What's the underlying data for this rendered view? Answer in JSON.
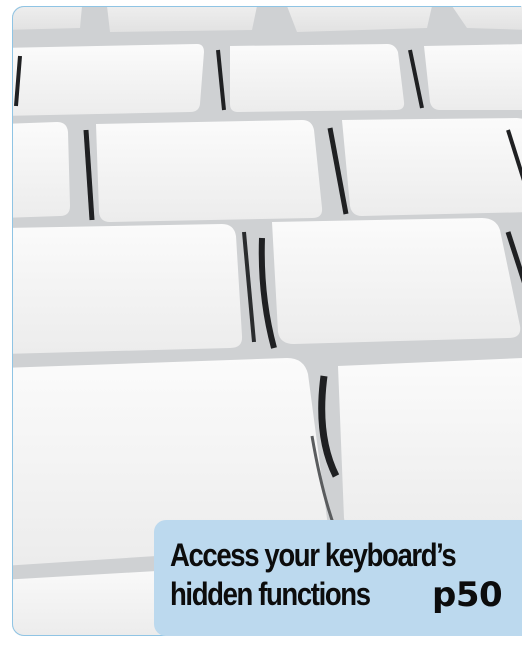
{
  "caption": {
    "line1": "Access your keyboard’s",
    "line2": "hidden functions",
    "page_ref": "p50"
  },
  "image": {
    "subject": "keyboard-keys-photo"
  },
  "colors": {
    "caption_background": "#bcd9ee",
    "panel_border": "#8fc4e4",
    "key_surface": "#f7f7f7",
    "key_gap": "#2a2c2e"
  }
}
